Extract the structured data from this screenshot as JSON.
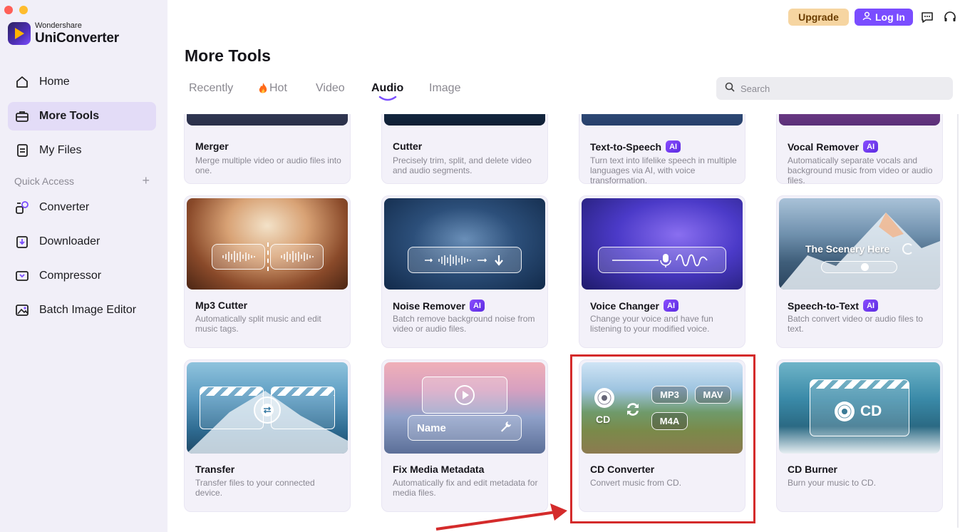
{
  "app": {
    "brand_small": "Wondershare",
    "brand_big": "UniConverter"
  },
  "header": {
    "upgrade": "Upgrade",
    "login": "Log In"
  },
  "sidebar": {
    "items": [
      {
        "label": "Home",
        "icon": "home-icon"
      },
      {
        "label": "More Tools",
        "icon": "toolbox-icon",
        "active": true
      },
      {
        "label": "My Files",
        "icon": "file-icon"
      }
    ],
    "quick_access_label": "Quick Access",
    "quick_items": [
      {
        "label": "Converter",
        "icon": "converter-icon"
      },
      {
        "label": "Downloader",
        "icon": "downloader-icon"
      },
      {
        "label": "Compressor",
        "icon": "compressor-icon"
      },
      {
        "label": "Batch Image Editor",
        "icon": "image-edit-icon"
      }
    ]
  },
  "page": {
    "title": "More Tools"
  },
  "tabs": [
    {
      "label": "Recently"
    },
    {
      "label": "Hot",
      "icon": "fire-icon"
    },
    {
      "label": "Video"
    },
    {
      "label": "Audio",
      "active": true
    },
    {
      "label": "Image"
    }
  ],
  "search": {
    "placeholder": "Search"
  },
  "tools": [
    {
      "title": "Merger",
      "desc": "Merge multiple video or audio files into one.",
      "ai": false
    },
    {
      "title": "Cutter",
      "desc": "Precisely trim, split, and delete video and audio segments.",
      "ai": false
    },
    {
      "title": "Text-to-Speech",
      "desc": "Turn text into lifelike speech in multiple languages via AI, with voice transformation.",
      "ai": true
    },
    {
      "title": "Vocal Remover",
      "desc": "Automatically separate vocals and background music from video or audio files.",
      "ai": true
    },
    {
      "title": "Mp3 Cutter",
      "desc": "Automatically split music and edit music tags.",
      "ai": false
    },
    {
      "title": "Noise Remover",
      "desc": "Batch remove background noise from video or audio files.",
      "ai": true
    },
    {
      "title": "Voice Changer",
      "desc": "Change your voice and have fun listening to your modified voice.",
      "ai": true
    },
    {
      "title": "Speech-to-Text",
      "desc": "Batch convert video or audio files to text.",
      "ai": true
    },
    {
      "title": "Transfer",
      "desc": "Transfer files to your connected device.",
      "ai": false
    },
    {
      "title": "Fix Media Metadata",
      "desc": "Automatically fix and edit metadata for media files.",
      "ai": false
    },
    {
      "title": "CD Converter",
      "desc": "Convert music from CD.",
      "ai": false
    },
    {
      "title": "CD Burner",
      "desc": "Burn your music to CD.",
      "ai": false
    }
  ],
  "ai_badge": "AI",
  "thumb_text": {
    "scenery": "The Scenery Here",
    "name": "Name",
    "mp3": "MP3",
    "mav": "MAV",
    "m4a": "M4A",
    "cd": "CD",
    "cd_big": "CD"
  },
  "colors": {
    "accent": "#7a4dff",
    "highlight": "#d42b2b",
    "upgrade_bg": "#f6d5a1"
  }
}
